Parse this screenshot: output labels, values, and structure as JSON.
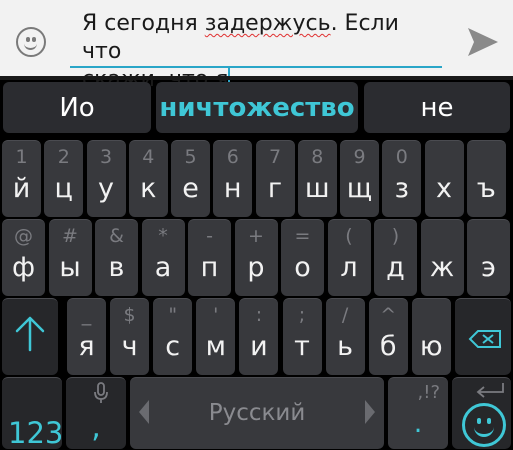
{
  "compose": {
    "line1_before": "Я сегодня ",
    "line1_misspelled": "задержусь",
    "line1_after": ". Если что",
    "line2": "скажи, что я"
  },
  "predictions": [
    "Ио",
    "ничтожество",
    "не"
  ],
  "row1": [
    {
      "sub": "1",
      "main": "й"
    },
    {
      "sub": "2",
      "main": "ц"
    },
    {
      "sub": "3",
      "main": "у"
    },
    {
      "sub": "4",
      "main": "к"
    },
    {
      "sub": "5",
      "main": "е"
    },
    {
      "sub": "6",
      "main": "н"
    },
    {
      "sub": "7",
      "main": "г"
    },
    {
      "sub": "8",
      "main": "ш"
    },
    {
      "sub": "9",
      "main": "щ"
    },
    {
      "sub": "0",
      "main": "з"
    },
    {
      "sub": "",
      "main": "х"
    },
    {
      "sub": "",
      "main": "ъ"
    }
  ],
  "row2": [
    {
      "sub": "@",
      "main": "ф"
    },
    {
      "sub": "#",
      "main": "ы"
    },
    {
      "sub": "&",
      "main": "в"
    },
    {
      "sub": "*",
      "main": "а"
    },
    {
      "sub": "-",
      "main": "п"
    },
    {
      "sub": "+",
      "main": "р"
    },
    {
      "sub": "=",
      "main": "о"
    },
    {
      "sub": "(",
      "main": "л"
    },
    {
      "sub": ")",
      "main": "д"
    },
    {
      "sub": "",
      "main": "ж"
    },
    {
      "sub": "",
      "main": "э"
    }
  ],
  "row3": [
    {
      "sub": "_",
      "main": "я"
    },
    {
      "sub": "$",
      "main": "ч"
    },
    {
      "sub": "\"",
      "main": "с"
    },
    {
      "sub": "'",
      "main": "м"
    },
    {
      "sub": ":",
      "main": "и"
    },
    {
      "sub": ";",
      "main": "т"
    },
    {
      "sub": "/",
      "main": "ь"
    },
    {
      "sub": "^",
      "main": "б"
    },
    {
      "sub": "",
      "main": "ю"
    }
  ],
  "bottom": {
    "numbers_label": "123",
    "comma_label": ",",
    "space_label": "Русский",
    "period_sub": ",!?",
    "period_label": "."
  },
  "colors": {
    "accent": "#3fc7d6",
    "key": "#38393d",
    "background": "#000000",
    "compose_bg": "#f2f2f2"
  }
}
